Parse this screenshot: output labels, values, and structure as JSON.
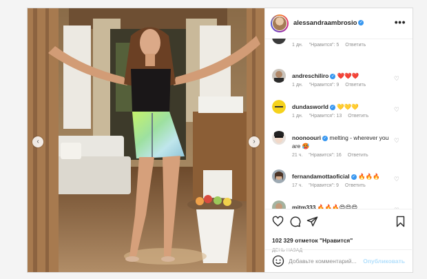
{
  "post": {
    "username": "alessandraambrosio",
    "more_icon": "more-horizontal-icon"
  },
  "comments": [
    {
      "username": "",
      "text": "",
      "age": "1 дн.",
      "likes": "\"Нравится\": 5",
      "reply": "Ответить",
      "avatar": "partial-avatar"
    },
    {
      "username": "andreschiliro",
      "text": "❤️❤️❤️",
      "age": "1 дн.",
      "likes": "\"Нравится\": 9",
      "reply": "Ответить",
      "avatar": "man-avatar"
    },
    {
      "username": "dundasworld",
      "text": "💛💛💛",
      "age": "1 дн.",
      "likes": "\"Нравится\": 13",
      "reply": "Ответить",
      "avatar": "dundas-logo-avatar"
    },
    {
      "username": "noonoouri",
      "text": "melting - wherever you are 🥵",
      "age": "21 ч.",
      "likes": "\"Нравится\": 16",
      "reply": "Ответить",
      "avatar": "woman-sunglasses-avatar"
    },
    {
      "username": "fernandamottaoficial",
      "text": "🔥🔥🔥",
      "age": "17 ч.",
      "likes": "\"Нравится\": 9",
      "reply": "Ответить",
      "avatar": "woman-avatar"
    },
    {
      "username": "mjtm333",
      "text": "🔥🔥🔥😍😍😍",
      "age": "",
      "likes": "",
      "reply": "",
      "avatar": "man-outdoor-avatar"
    }
  ],
  "actions": {
    "like_icon": "heart-icon",
    "comment_icon": "comment-icon",
    "share_icon": "send-icon",
    "save_icon": "bookmark-icon"
  },
  "likes_text": "102 329 отметок \"Нравится\"",
  "post_age": "ДЕНЬ НАЗАД",
  "add_comment": {
    "placeholder": "Добавьте комментарий...",
    "publish": "Опубликовать"
  },
  "colors": {
    "verified": "#3897f0",
    "link_disabled": "#b2dffc",
    "heart_red": "#ed4956",
    "muted": "#8e8e8e"
  }
}
